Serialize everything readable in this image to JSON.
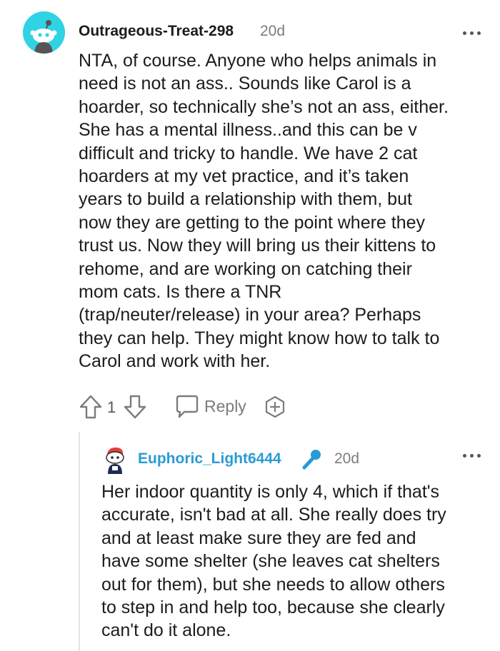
{
  "comment": {
    "username": "Outrageous-Treat-298",
    "time": "20d",
    "body_lines": [
      "NTA, of course. Anyone who helps animals in",
      "need is not an ass.. Sounds like Carol is a",
      "hoarder, so technically she’s not an ass, either.",
      "She has a mental illness..and this can be v",
      "difficult and tricky to handle. We have 2 cat",
      "hoarders at my vet practice, and it’s taken",
      "years to build a relationship with them, but",
      "now they are getting to the point where they",
      "trust us. Now they will bring us their kittens to",
      "rehome, and are working on catching their",
      "mom cats. Is there a TNR",
      "(trap/neuter/release) in your area? Perhaps",
      "they can help. They might know how to talk to",
      "Carol and work with her."
    ],
    "vote_count": "1",
    "reply_label": "Reply",
    "icons": {
      "avatar": "snoo-avatar-icon",
      "more": "more-options-icon",
      "upvote": "upvote-arrow-icon",
      "downvote": "downvote-arrow-icon",
      "reply": "reply-bubble-icon",
      "award": "award-plus-icon"
    }
  },
  "reply": {
    "username": "Euphoric_Light6444",
    "time": "20d",
    "body_lines": [
      "Her indoor quantity is only 4, which if that's",
      "accurate, isn't bad at all. She really does try",
      "and at least make sure they are fed and",
      "have some shelter (she leaves cat shelters",
      "out for them), but she needs to allow others",
      "to step in and help too, because she clearly",
      "can't do it alone."
    ],
    "icons": {
      "avatar": "snoo-avatar-icon",
      "flair": "microphone-icon",
      "more": "more-options-icon"
    }
  },
  "colors": {
    "avatar_bg": "#2fd3e3",
    "reply_username": "#2a9ad6",
    "meta_gray": "#7c7c7c",
    "thread_line": "#e4e4e4"
  }
}
